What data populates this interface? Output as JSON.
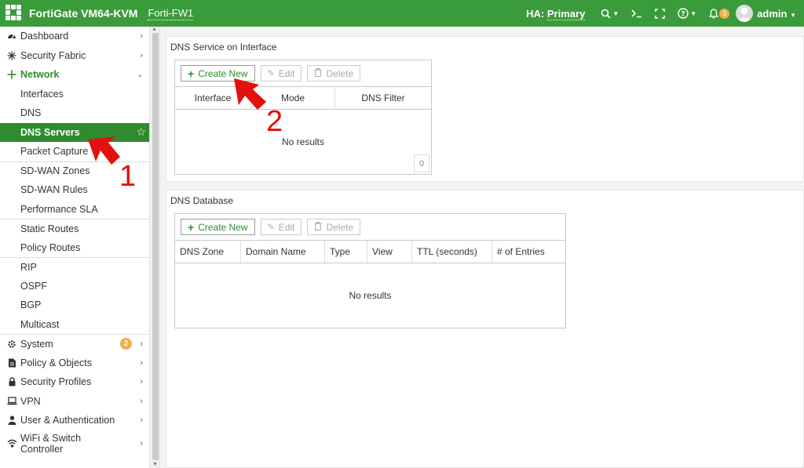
{
  "topbar": {
    "device_name": "FortiGate VM64-KVM",
    "hostname": "Forti-FW1",
    "ha_label": "HA:",
    "ha_value": "Primary",
    "notification_count": "3",
    "user": "admin"
  },
  "sidebar": {
    "items": [
      {
        "label": "Dashboard",
        "icon": "dashboard-icon"
      },
      {
        "label": "Security Fabric",
        "icon": "security-fabric-icon"
      },
      {
        "label": "Network",
        "icon": "network-icon"
      },
      {
        "label": "Interfaces"
      },
      {
        "label": "DNS"
      },
      {
        "label": "DNS Servers"
      },
      {
        "label": "Packet Capture"
      },
      {
        "label": "SD-WAN Zones"
      },
      {
        "label": "SD-WAN Rules"
      },
      {
        "label": "Performance SLA"
      },
      {
        "label": "Static Routes"
      },
      {
        "label": "Policy Routes"
      },
      {
        "label": "RIP"
      },
      {
        "label": "OSPF"
      },
      {
        "label": "BGP"
      },
      {
        "label": "Multicast"
      },
      {
        "label": "System",
        "icon": "gear-icon",
        "badge": "2"
      },
      {
        "label": "Policy & Objects",
        "icon": "policy-icon"
      },
      {
        "label": "Security Profiles",
        "icon": "lock-icon"
      },
      {
        "label": "VPN",
        "icon": "laptop-icon"
      },
      {
        "label": "User & Authentication",
        "icon": "user-icon"
      },
      {
        "label_line1": "WiFi & Switch",
        "label_line2": "Controller",
        "icon": "wifi-icon"
      }
    ]
  },
  "dns_service": {
    "title": "DNS Service on Interface",
    "create_label": "Create New",
    "edit_label": "Edit",
    "delete_label": "Delete",
    "columns": [
      "Interface",
      "Mode",
      "DNS Filter"
    ],
    "empty_text": "No results",
    "count": "0"
  },
  "dns_database": {
    "title": "DNS Database",
    "create_label": "Create New",
    "edit_label": "Edit",
    "delete_label": "Delete",
    "columns": [
      "DNS Zone",
      "Domain Name",
      "Type",
      "View",
      "TTL (seconds)",
      "# of Entries"
    ],
    "empty_text": "No results"
  },
  "annotations": {
    "step1": "1",
    "step2": "2",
    "color": "#e4100d"
  },
  "colors": {
    "brand_green": "#3a9b3a",
    "active_green": "#2e8b2e",
    "badge_orange": "#f0ad4e"
  }
}
